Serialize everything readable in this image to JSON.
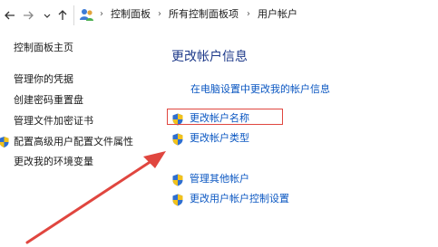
{
  "address_bar": {
    "breadcrumbs": [
      "控制面板",
      "所有控制面板项",
      "用户帐户"
    ],
    "icons": [
      "back-arrow",
      "forward-arrow",
      "dropdown-chevron",
      "up-arrow",
      "users-icon"
    ]
  },
  "sidebar": {
    "home": "控制面板主页",
    "items": [
      {
        "label": "管理你的凭据"
      },
      {
        "label": "创建密码重置盘"
      },
      {
        "label": "管理文件加密证书"
      },
      {
        "label": "配置高级用户配置文件属性",
        "icon": "shield"
      },
      {
        "label": "更改我的环境变量"
      }
    ]
  },
  "main": {
    "title": "更改帐户信息",
    "pc_settings_link": "在电脑设置中更改我的帐户信息",
    "actions": [
      {
        "label": "更改帐户名称",
        "icon": "shield",
        "highlighted": true
      },
      {
        "label": "更改帐户类型",
        "icon": "shield"
      },
      {
        "label": "管理其他帐户",
        "icon": "shield"
      },
      {
        "label": "更改用户帐户控制设置",
        "icon": "shield"
      }
    ]
  },
  "annotation": {
    "color": "#e0463f"
  },
  "colors": {
    "link": "#0b57c2",
    "title": "#1e3a8a",
    "accent": "#e0463f"
  }
}
